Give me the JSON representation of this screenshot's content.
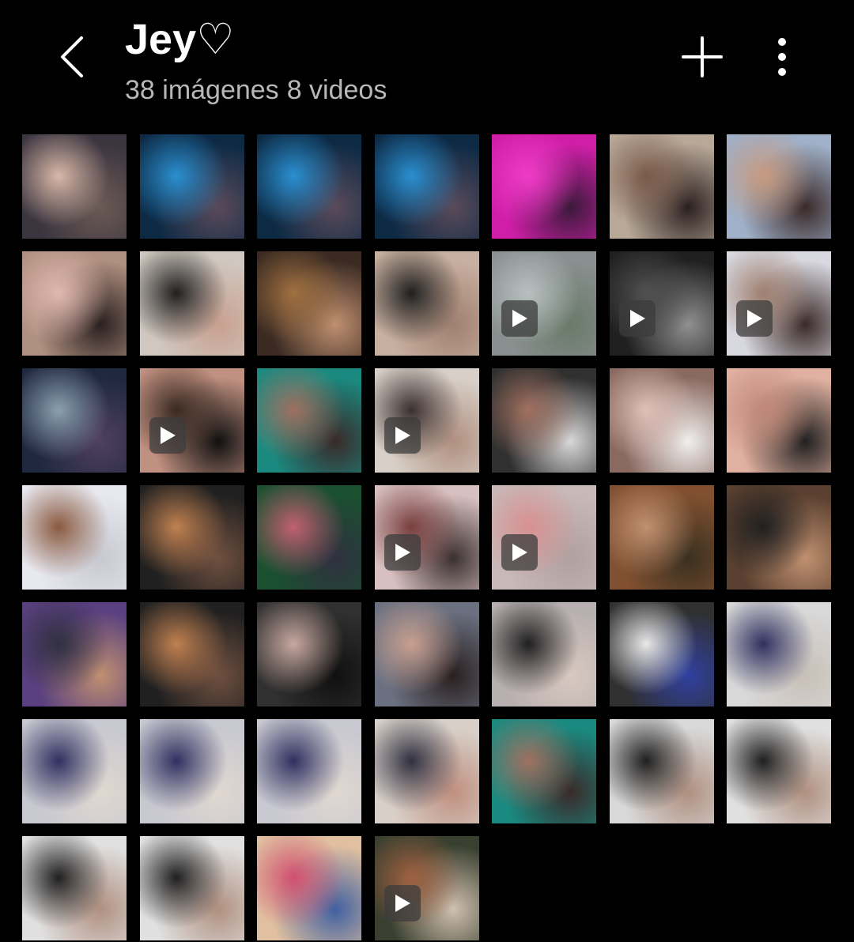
{
  "header": {
    "title": "Jey♡",
    "count_images": "38 imágenes",
    "count_videos": "8 videos"
  },
  "icons": {
    "back": "chevron-left-icon",
    "add": "plus-icon",
    "more": "more-vertical-icon",
    "play": "play-icon"
  },
  "colors": {
    "background": "#000000",
    "subtitle": "#b8b8b8"
  },
  "items": [
    {
      "video": false,
      "colors": [
        "#3b3540",
        "#d9b8a8",
        "#6b5a55"
      ]
    },
    {
      "video": false,
      "colors": [
        "#0d2a45",
        "#2a8fd0",
        "#5a4a5a"
      ]
    },
    {
      "video": false,
      "colors": [
        "#0d2a45",
        "#2a8fd0",
        "#5a4a5a"
      ]
    },
    {
      "video": false,
      "colors": [
        "#0d2a45",
        "#2a8fd0",
        "#5a4a5a"
      ]
    },
    {
      "video": false,
      "colors": [
        "#d01ea8",
        "#f03cc8",
        "#3a1a3a"
      ]
    },
    {
      "video": false,
      "colors": [
        "#b8a898",
        "#7a5a4a",
        "#2a2020"
      ]
    },
    {
      "video": false,
      "colors": [
        "#9fb0c8",
        "#c89a80",
        "#3a2a2a"
      ]
    },
    {
      "video": false,
      "colors": [
        "#b09080",
        "#e0b8b0",
        "#2a2020"
      ]
    },
    {
      "video": false,
      "colors": [
        "#d0c8c0",
        "#202020",
        "#c8a090"
      ]
    },
    {
      "video": false,
      "colors": [
        "#3a2a22",
        "#a07040",
        "#c09070"
      ]
    },
    {
      "video": false,
      "colors": [
        "#c8b0a0",
        "#202020",
        "#a08070"
      ]
    },
    {
      "video": true,
      "colors": [
        "#8a9090",
        "#b8c0c0",
        "#6a7a6a"
      ]
    },
    {
      "video": true,
      "colors": [
        "#202020",
        "#505050",
        "#909090"
      ]
    },
    {
      "video": true,
      "colors": [
        "#d8d8e0",
        "#a08070",
        "#3a2a28"
      ]
    },
    {
      "video": false,
      "colors": [
        "#202840",
        "#8aa0b0",
        "#504060"
      ]
    },
    {
      "video": true,
      "colors": [
        "#c09080",
        "#3a2a22",
        "#101010"
      ]
    },
    {
      "video": false,
      "colors": [
        "#1a8a80",
        "#a07060",
        "#3a2a2a"
      ]
    },
    {
      "video": true,
      "colors": [
        "#d8d0c8",
        "#3a3030",
        "#b09080"
      ]
    },
    {
      "video": false,
      "colors": [
        "#303030",
        "#a07060",
        "#d8d8d8"
      ]
    },
    {
      "video": false,
      "colors": [
        "#8a6a60",
        "#e0c0b8",
        "#f0f0f0"
      ]
    },
    {
      "video": false,
      "colors": [
        "#e0b0a0",
        "#c08878",
        "#202020"
      ]
    },
    {
      "video": false,
      "colors": [
        "#e8e8f0",
        "#8a5a40",
        "#c8c8d0"
      ]
    },
    {
      "video": false,
      "colors": [
        "#202020",
        "#c08050",
        "#705040"
      ]
    },
    {
      "video": false,
      "colors": [
        "#1a5030",
        "#c06070",
        "#303040"
      ]
    },
    {
      "video": true,
      "colors": [
        "#d8c0c0",
        "#7a4040",
        "#3a3030"
      ]
    },
    {
      "video": true,
      "colors": [
        "#c8b8b8",
        "#d89090",
        "#b0a0a0"
      ]
    },
    {
      "video": false,
      "colors": [
        "#805030",
        "#c09070",
        "#3a3020"
      ]
    },
    {
      "video": false,
      "colors": [
        "#5a4030",
        "#202020",
        "#c09070"
      ]
    },
    {
      "video": false,
      "colors": [
        "#5a4080",
        "#303040",
        "#c09070"
      ]
    },
    {
      "video": false,
      "colors": [
        "#202020",
        "#c08050",
        "#705040"
      ]
    },
    {
      "video": false,
      "colors": [
        "#303030",
        "#c8a8a0",
        "#101010"
      ]
    },
    {
      "video": false,
      "colors": [
        "#6a7080",
        "#c8a090",
        "#2a2020"
      ]
    },
    {
      "video": false,
      "colors": [
        "#b8b0b0",
        "#202020",
        "#d8c8c0"
      ]
    },
    {
      "video": false,
      "colors": [
        "#303030",
        "#e8e8e8",
        "#3040a0"
      ]
    },
    {
      "video": false,
      "colors": [
        "#d8d8d8",
        "#303060",
        "#c8c0b8"
      ]
    },
    {
      "video": false,
      "colors": [
        "#c8c8d0",
        "#303060",
        "#e0d8d0"
      ]
    },
    {
      "video": false,
      "colors": [
        "#c8c8d0",
        "#303060",
        "#e0d8d0"
      ]
    },
    {
      "video": false,
      "colors": [
        "#c8c8d0",
        "#303060",
        "#e0d8d0"
      ]
    },
    {
      "video": false,
      "colors": [
        "#d8d0c8",
        "#303040",
        "#c09080"
      ]
    },
    {
      "video": false,
      "colors": [
        "#1a8a80",
        "#a07060",
        "#3a2a2a"
      ]
    },
    {
      "video": false,
      "colors": [
        "#d8d8d8",
        "#202020",
        "#b09080"
      ]
    },
    {
      "video": false,
      "colors": [
        "#e0e0e0",
        "#202020",
        "#b09080"
      ]
    },
    {
      "video": false,
      "colors": [
        "#e0e0e0",
        "#202020",
        "#b09080"
      ]
    },
    {
      "video": false,
      "colors": [
        "#e0e0e0",
        "#202020",
        "#b09080"
      ]
    },
    {
      "video": false,
      "colors": [
        "#e0c0a0",
        "#d05070",
        "#4060a0"
      ]
    },
    {
      "video": true,
      "colors": [
        "#3a4030",
        "#a06040",
        "#d0c0b0"
      ]
    }
  ]
}
